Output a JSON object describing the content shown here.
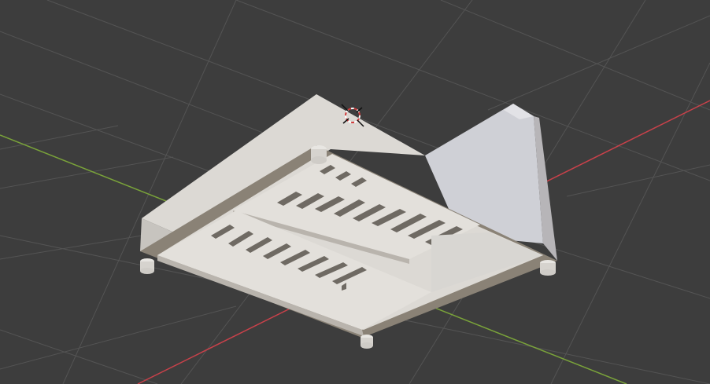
{
  "viewport": {
    "background": "#3d3d3d",
    "grid_color": "#545454",
    "x_axis_color": "#c8414a",
    "y_axis_color": "#7aa33a"
  },
  "model": {
    "top_color": "#dcd9d4",
    "side_color": "#c7c4bf",
    "shadow_color": "#8a8276",
    "cavity_color": "#6f6a63",
    "end_wall_color": "#cfd0d6"
  },
  "cursor": {
    "icon": "3d-cursor-icon",
    "ring_colors": [
      "#d13b3b",
      "#ffffff"
    ]
  }
}
